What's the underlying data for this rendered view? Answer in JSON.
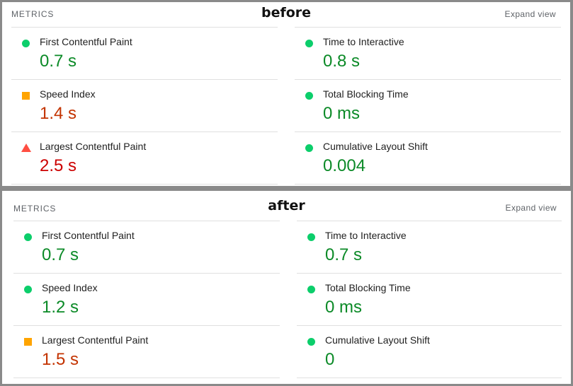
{
  "before": {
    "caption": "before",
    "header_label": "METRICS",
    "expand_label": "Expand view",
    "metrics": [
      {
        "name": "First Contentful Paint",
        "value": "0.7 s",
        "rating": "good",
        "icon": "green-circle-icon"
      },
      {
        "name": "Time to Interactive",
        "value": "0.8 s",
        "rating": "good",
        "icon": "green-circle-icon"
      },
      {
        "name": "Speed Index",
        "value": "1.4 s",
        "rating": "average",
        "icon": "orange-square-icon"
      },
      {
        "name": "Total Blocking Time",
        "value": "0 ms",
        "rating": "good",
        "icon": "green-circle-icon"
      },
      {
        "name": "Largest Contentful Paint",
        "value": "2.5 s",
        "rating": "poor",
        "icon": "red-triangle-icon"
      },
      {
        "name": "Cumulative Layout Shift",
        "value": "0.004",
        "rating": "good",
        "icon": "green-circle-icon"
      }
    ]
  },
  "after": {
    "caption": "after",
    "header_label": "METRICS",
    "expand_label": "Expand view",
    "metrics": [
      {
        "name": "First Contentful Paint",
        "value": "0.7 s",
        "rating": "good",
        "icon": "green-circle-icon"
      },
      {
        "name": "Time to Interactive",
        "value": "0.7 s",
        "rating": "good",
        "icon": "green-circle-icon"
      },
      {
        "name": "Speed Index",
        "value": "1.2 s",
        "rating": "good",
        "icon": "green-circle-icon"
      },
      {
        "name": "Total Blocking Time",
        "value": "0 ms",
        "rating": "good",
        "icon": "green-circle-icon"
      },
      {
        "name": "Largest Contentful Paint",
        "value": "1.5 s",
        "rating": "average",
        "icon": "orange-square-icon"
      },
      {
        "name": "Cumulative Layout Shift",
        "value": "0",
        "rating": "good",
        "icon": "green-circle-icon"
      }
    ]
  },
  "colors": {
    "good_icon": "#0cce6b",
    "average_icon": "#ffa400",
    "poor_icon": "#ff4e42",
    "good_text": "#0b8a27",
    "average_text": "#c33300",
    "poor_text": "#cc0000"
  }
}
